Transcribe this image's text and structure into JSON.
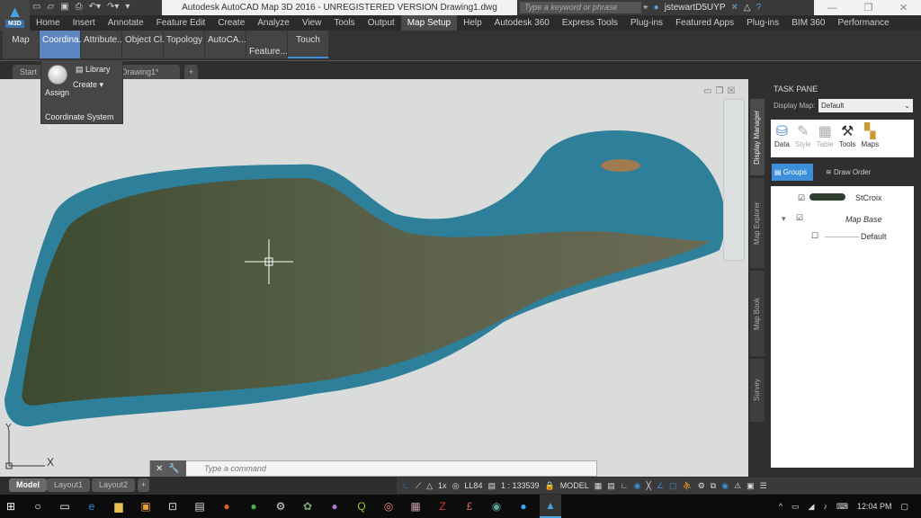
{
  "title_bar": {
    "app_badge": "M3D",
    "title": "Autodesk AutoCAD Map 3D 2016 - UNREGISTERED VERSION    Drawing1.dwg",
    "search_placeholder": "Type a keyword or phrase",
    "username": "jstewartD5UYP"
  },
  "menu_tabs": [
    "Home",
    "Insert",
    "Annotate",
    "Feature Edit",
    "Create",
    "Analyze",
    "View",
    "Tools",
    "Output",
    "Map Setup",
    "Help",
    "Autodesk 360",
    "Express Tools",
    "Plug-ins",
    "Featured Apps",
    "Plug-ins",
    "BIM 360",
    "Performance"
  ],
  "active_menu_tab": "Map Setup",
  "ribbon_panels": [
    "Map",
    "Coordina...",
    "Attribute...",
    "Object Cl...",
    "Topology",
    "AutoCA...",
    "Feature...",
    "Touch"
  ],
  "active_ribbon_panel": "Coordina...",
  "coordinate_dropdown": {
    "assign": "Assign",
    "library": "Library",
    "create": "Create",
    "footer": "Coordinate System"
  },
  "file_tabs": {
    "start": "Start",
    "drawing": "Drawing1*"
  },
  "command_line": {
    "placeholder": "Type a command"
  },
  "layout_tabs": [
    "Model",
    "Layout1",
    "Layout2"
  ],
  "status_bar": {
    "annotation_scale": "1x",
    "coord_system": "LL84",
    "scale": "1 : 133539",
    "space": "MODEL"
  },
  "task_pane": {
    "title": "TASK PANE",
    "display_map_label": "Display Map:",
    "display_map_value": "Default",
    "tools": [
      "Data",
      "Style",
      "Table",
      "Tools",
      "Maps"
    ],
    "view_buttons": {
      "groups": "Groups",
      "draw_order": "Draw Order"
    },
    "layers": [
      {
        "name": "StCroix",
        "checked": true
      },
      {
        "name": "Map Base",
        "checked": true
      },
      {
        "name": "Default",
        "checked": false
      }
    ],
    "side_tabs": [
      "Display Manager",
      "Map Explorer",
      "Map Book",
      "Survey"
    ]
  },
  "taskbar": {
    "clock": "12:04 PM"
  },
  "colors": {
    "accent": "#5b86c0",
    "canvas": "#d9dcdb",
    "sea": "#3a8fa8",
    "land": "#4a5a3a"
  }
}
